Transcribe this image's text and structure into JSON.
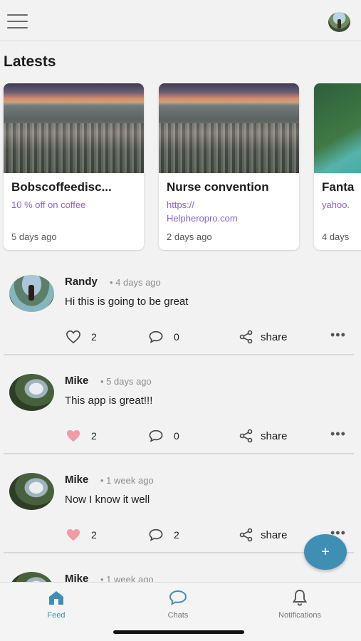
{
  "header": {
    "menu_icon": "hamburger-menu-icon",
    "avatar_icon": "user-avatar"
  },
  "latest": {
    "title": "Latests",
    "cards": [
      {
        "title": "Bobscoffeedisc...",
        "link": "10 % off on coffee",
        "date": "5 days ago"
      },
      {
        "title": "Nurse convention",
        "link": "https://\nHelpheropro.com",
        "date": "2 days ago"
      },
      {
        "title": "Fanta",
        "link": "yahoo.",
        "date": "4 days"
      }
    ]
  },
  "posts": [
    {
      "name": "Randy",
      "time": "• 4 days ago",
      "text": "Hi this is going to be great",
      "likes": "2",
      "liked": false,
      "comments": "0",
      "share": "share"
    },
    {
      "name": "Mike",
      "time": "• 5 days ago",
      "text": "This app is great!!!",
      "likes": "2",
      "liked": true,
      "comments": "0",
      "share": "share"
    },
    {
      "name": "Mike",
      "time": "• 1 week ago",
      "text": "Now I know it well",
      "likes": "2",
      "liked": true,
      "comments": "2",
      "share": "share"
    },
    {
      "name": "Mike",
      "time": "• 1 week ago"
    }
  ],
  "fab": {
    "label": "+"
  },
  "tabs": [
    {
      "label": "Feed",
      "icon": "home-icon",
      "active": true
    },
    {
      "label": "Chats",
      "icon": "chat-bubble-icon",
      "active": false
    },
    {
      "label": "Notifications",
      "icon": "bell-icon",
      "active": false
    }
  ],
  "colors": {
    "accent": "#3f8fb5",
    "link": "#8a63d2",
    "heart_liked": "#f29aa6",
    "background": "#f2f2f3"
  }
}
